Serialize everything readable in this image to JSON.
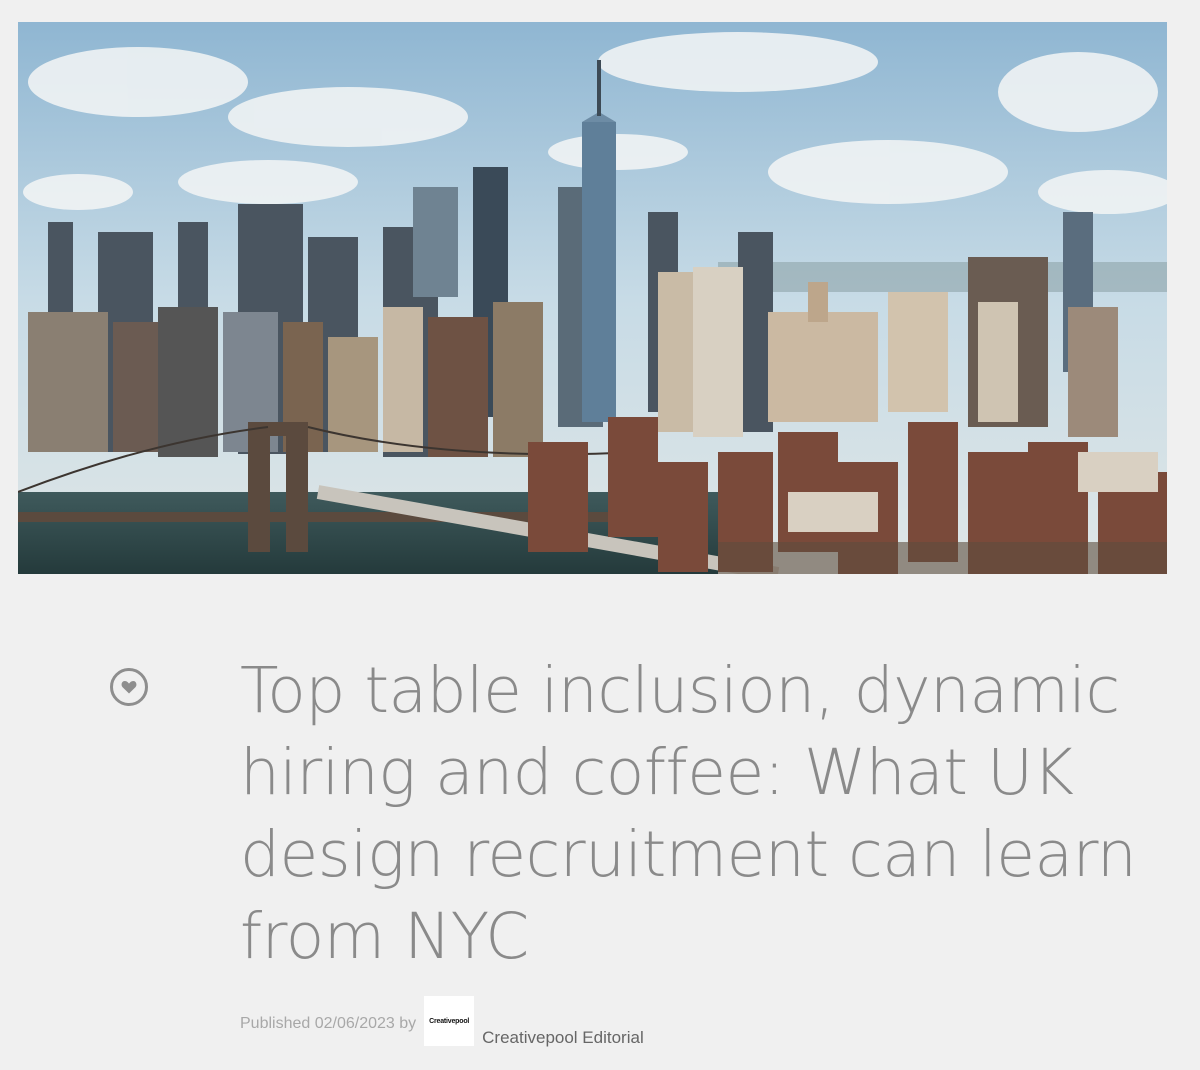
{
  "article": {
    "title": "Top table inclusion, dynamic hiring and coffee: What UK design recruitment can learn from NYC",
    "published_label": "Published 02/06/2023 by",
    "author_logo_text": "Creativepool",
    "author_name": "Creativepool Editorial",
    "hero_image": "nyc-skyline-photo"
  },
  "icons": {
    "like": "heart-icon"
  },
  "colors": {
    "background": "#f0f0f0",
    "title": "#8a8a8a",
    "meta": "#a8a8a8",
    "author": "#666666"
  }
}
